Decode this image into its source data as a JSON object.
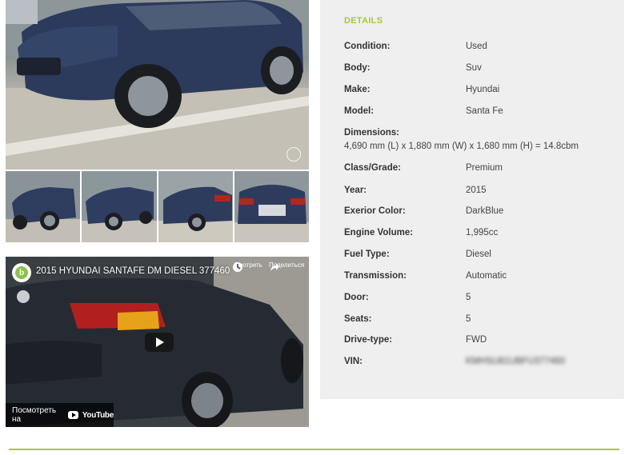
{
  "gallery": {
    "thumbnails": [
      "thumb-front-left",
      "thumb-front",
      "thumb-rear-left",
      "thumb-rear"
    ]
  },
  "video": {
    "title": "2015 HYUNDAI SANTAFE DM DIESEL 377460",
    "watch_later_label": "Смотреть",
    "share_label": "Поделиться",
    "watch_on_label": "Посмотреть на",
    "youtube_label": "YouTube",
    "logo_letter": "b"
  },
  "details": {
    "heading": "DETAILS",
    "rows": [
      {
        "label": "Condition:",
        "value": "Used"
      },
      {
        "label": "Body:",
        "value": "Suv"
      },
      {
        "label": "Make:",
        "value": "Hyundai"
      },
      {
        "label": "Model:",
        "value": "Santa Fe"
      },
      {
        "label": "Dimensions:",
        "value": "4,690 mm (L) x 1,880 mm (W) x 1,680 mm (H) = 14.8cbm"
      },
      {
        "label": "Class/Grade:",
        "value": "Premium"
      },
      {
        "label": "Year:",
        "value": "2015"
      },
      {
        "label": "Exerior Color:",
        "value": "DarkBlue"
      },
      {
        "label": "Engine Volume:",
        "value": "1,995cc"
      },
      {
        "label": "Fuel Type:",
        "value": "Diesel"
      },
      {
        "label": "Transmission:",
        "value": "Automatic"
      },
      {
        "label": "Door:",
        "value": "5"
      },
      {
        "label": "Seats:",
        "value": "5"
      },
      {
        "label": "Drive-type:",
        "value": "FWD"
      },
      {
        "label": "VIN:",
        "value": "KMHSU81UBFU377460"
      }
    ]
  },
  "colors": {
    "accent": "#a7c83b",
    "panel_bg": "#efefef"
  }
}
